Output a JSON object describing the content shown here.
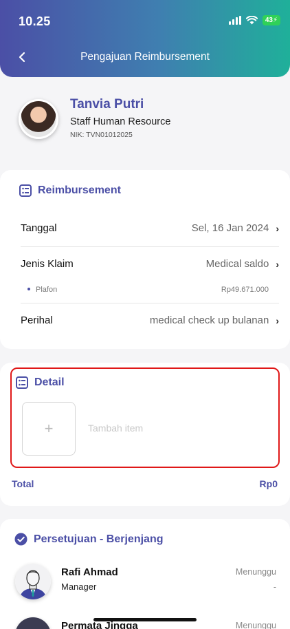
{
  "status_bar": {
    "time": "10.25",
    "battery": "43"
  },
  "header": {
    "title": "Pengajuan Reimbursement"
  },
  "profile": {
    "name": "Tanvia Putri",
    "role": "Staff Human Resource",
    "nik": "NIK: TVN01012025"
  },
  "reimbursement": {
    "title": "Reimbursement",
    "rows": [
      {
        "label": "Tanggal",
        "value": "Sel, 16 Jan 2024"
      },
      {
        "label": "Jenis Klaim",
        "value": "Medical saldo"
      },
      {
        "label": "Perihal",
        "value": "medical check up bulanan"
      }
    ],
    "plafon": {
      "label": "Plafon",
      "value": "Rp49.671.000"
    }
  },
  "detail": {
    "title": "Detail",
    "add_label": "Tambah item",
    "total_label": "Total",
    "total_value": "Rp0"
  },
  "approval": {
    "title": "Persetujuan - Berjenjang",
    "approvers": [
      {
        "name": "Rafi Ahmad",
        "role": "Manager",
        "status": "Menunggu",
        "note": "-"
      },
      {
        "name": "Permata Jingga",
        "role": "",
        "status": "Menunggu",
        "note": ""
      }
    ]
  },
  "colors": {
    "accent": "#4b4fa6",
    "highlight": "#e01818",
    "header_end": "#1fb09a"
  }
}
